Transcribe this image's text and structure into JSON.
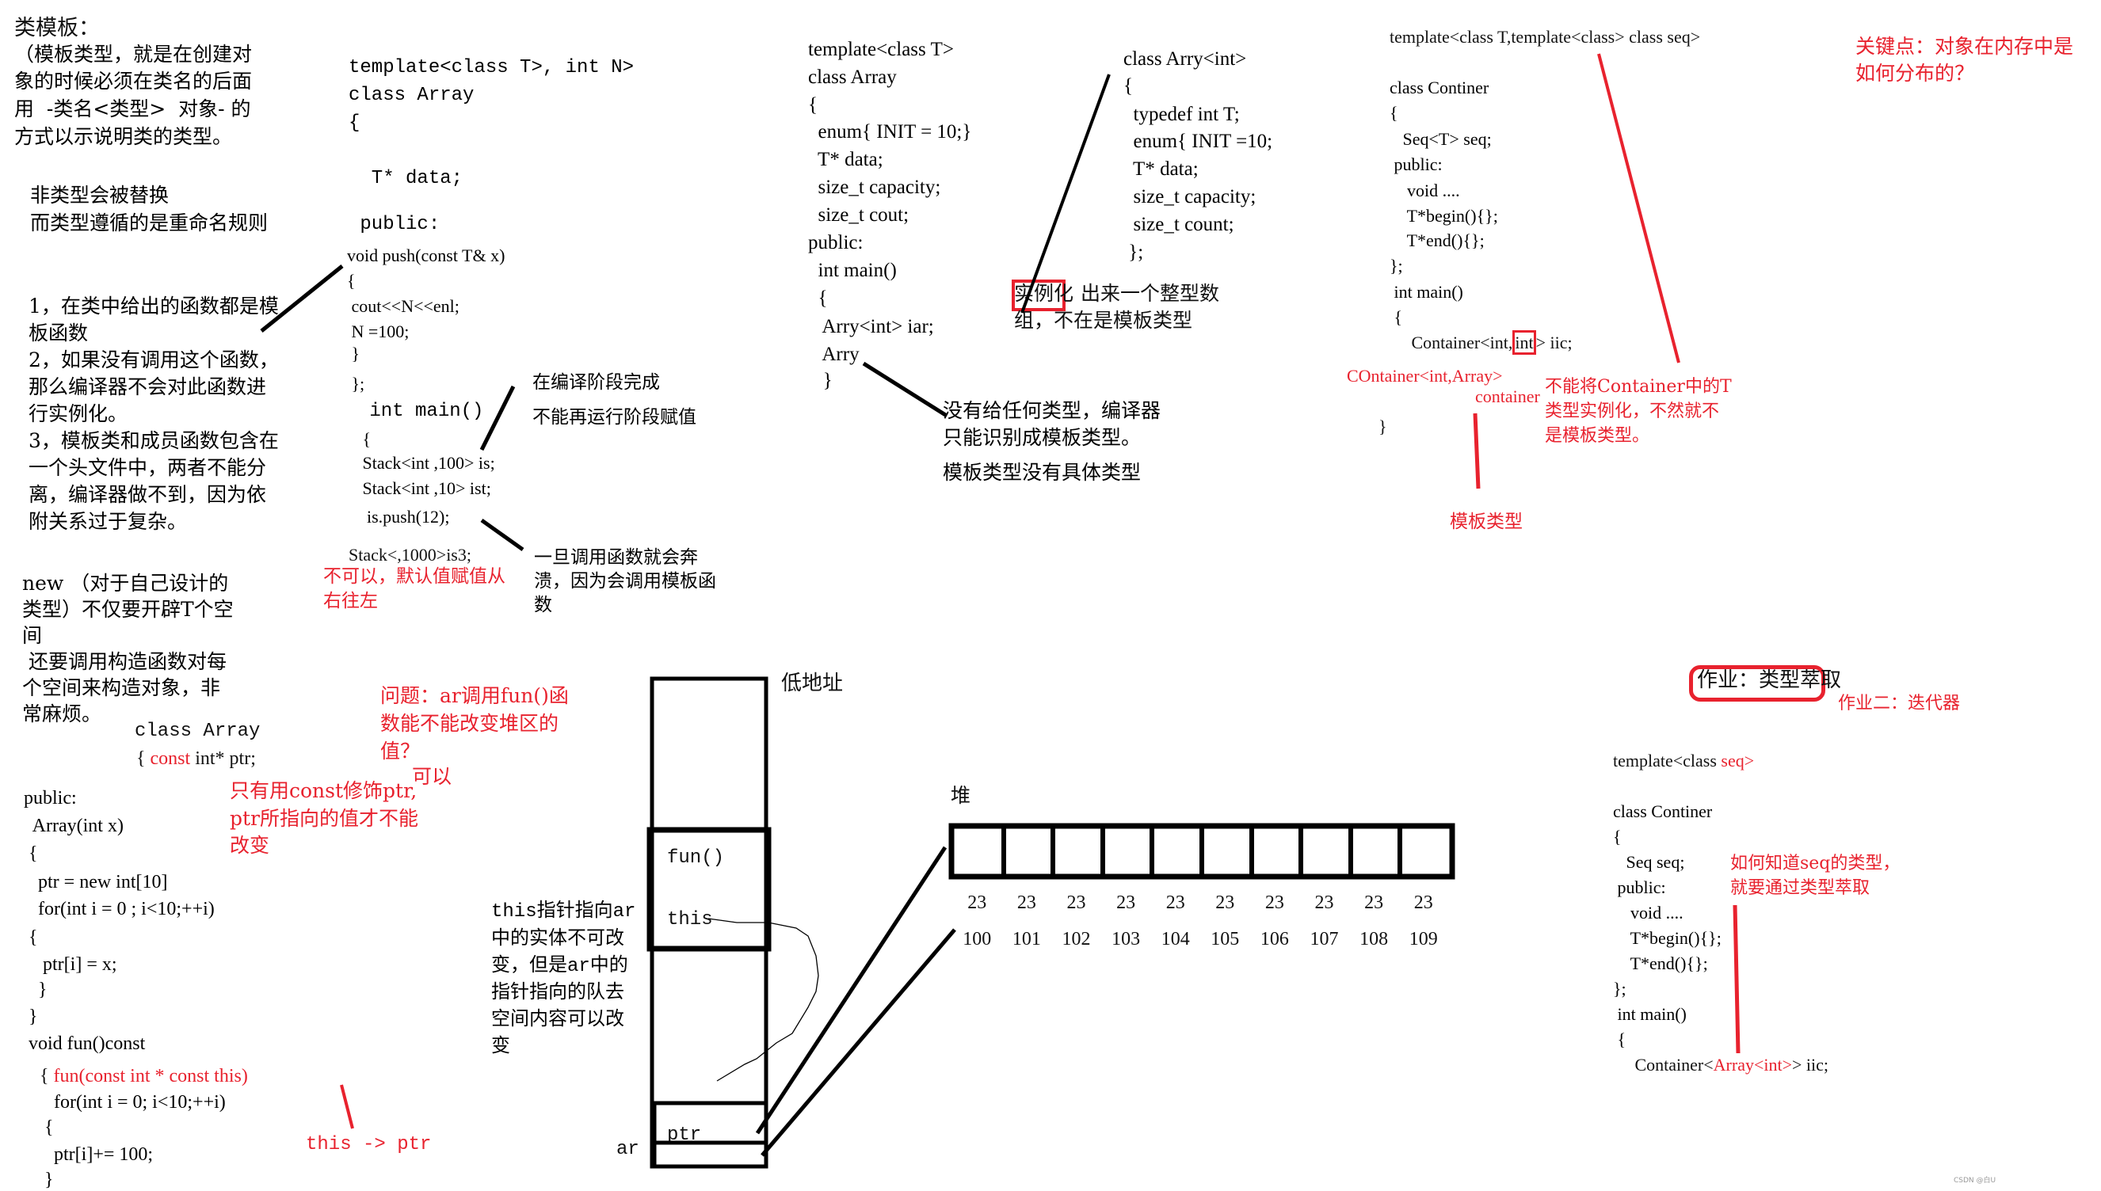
{
  "left_notes": {
    "title": "类模板：",
    "intro": [
      "（模板类型，就是在创建对",
      "象的时候必须在类名的后面",
      "用  -类名<类型>  对象- 的",
      "方式以示说明类的类型。"
    ],
    "rule": [
      "非类型会被替换",
      "而类型遵循的是重命名规则"
    ],
    "points": [
      "1，在类中给出的函数都是模",
      "板函数",
      "2，如果没有调用这个函数，",
      "那么编译器不会对此函数进",
      "行实例化。",
      "3，模板类和成员函数包含在",
      "一个头文件中，两者不能分",
      "离，编译器做不到，因为依",
      "附关系过于复杂。"
    ],
    "new_note": [
      "new （对于自己设计的",
      "类型）不仅要开辟T个空",
      "间",
      " 还要调用构造函数对每",
      "个空间来构造对象，非",
      "常麻烦。"
    ]
  },
  "code_stack": {
    "lines": [
      "template<class T>, int N>",
      "class Array",
      "{",
      "",
      "  T* data;",
      "",
      " public:",
      "void push(const T& x)",
      "{",
      " cout<<N<<enl;",
      " N =100;",
      " }",
      " };",
      " int main()",
      " {",
      " Stack<int ,100> is;",
      " Stack<int ,10> ist;",
      "  is.push(12);"
    ],
    "is3_line": "Stack<,1000>is3;",
    "is3_note": [
      "不可以，默认值赋值从",
      "右往左"
    ],
    "compile_note": [
      "在编译阶段完成",
      "不能再运行阶段赋值"
    ],
    "crash_note": [
      "一旦调用函数就会奔",
      "溃，因为会调用模板函",
      "数"
    ]
  },
  "code_array": {
    "lines": [
      "template<class T>",
      "class Array",
      "{",
      "  enum{ INIT = 10;}",
      "  T* data;",
      "  size_t capacity;",
      "  size_t cout;",
      "public:",
      "  int main()",
      "  {",
      "   Arry<int> iar;",
      "   Arry",
      "   }"
    ],
    "inst_lines": [
      "class Arry<int>",
      "{",
      "  typedef int T;",
      "  enum{ INIT =10;",
      "  T* data;",
      "  size_t capacity;",
      "  size_t count;",
      " };"
    ],
    "inst_highlight": "实例化",
    "inst_note_rest": "出来一个整型数",
    "inst_note_line2": "组，不在是模板类型",
    "no_type_note": [
      "没有给任何类型，编译器",
      "只能识别成模板类型。",
      "模板类型没有具体类型"
    ]
  },
  "code_container": {
    "header": "template<class T,template<class> class seq>",
    "lines": [
      "class Continer",
      "{",
      "   Seq<T> seq;",
      " public:",
      "    void ....",
      "    T*begin(){};",
      "    T*end(){};",
      "};",
      " int main()",
      " {"
    ],
    "decl_prefix": "     Container<int,",
    "decl_boxed": "int",
    "decl_suffix": "> iic;",
    "red_decl": "COntainer<int,Array>",
    "red_container": "container",
    "close_brace": "}",
    "template_type_note": "模板类型",
    "cannot_note": [
      "不能将Container中的T",
      "类型实例化，不然就不",
      "是模板类型。"
    ]
  },
  "key_point": [
    "关键点：对象在内存中是",
    "如何分布的？"
  ],
  "homework": {
    "title": "作业：类型萃取",
    "second": "作业二：迭代器",
    "header_prefix": "template<class",
    "header_red": "seq>",
    "lines": [
      "class Continer",
      "{",
      "   Seq seq;",
      " public:",
      "    void ....",
      "    T*begin(){};",
      "    T*end(){};",
      "};",
      " int main()",
      " {"
    ],
    "seq_note": [
      "如何知道seq的类型，",
      "就要通过类型萃取"
    ],
    "decl_prefix": "     Container<",
    "decl_red": "Array<int>",
    "decl_suffix": "> iic;"
  },
  "const_code": {
    "lines_a": [
      "class Array"
    ],
    "const_line_brace": "{ ",
    "const_line_red": "const",
    "const_line_rest": " int* ptr;",
    "lines_b": [
      "public:",
      "  Array(int x)",
      " {",
      "   ptr = new int[10]",
      "   for(int i = 0 ; i<10;++i)",
      " {",
      "    ptr[i] = x;",
      "   }",
      " }",
      " void fun()const"
    ],
    "fun_brace": "{ ",
    "fun_red": "fun(const int * const this)",
    "lines_c": [
      "   for(int i = 0; i<10;++i)",
      " {",
      "   ptr[i]+= 100;",
      " }"
    ],
    "this_ptr": "this -> ptr",
    "question": [
      "问题：ar调用fun()函",
      "数能不能改变堆区的",
      "值？"
    ],
    "can": "可以",
    "only_const": [
      "只有用const修饰ptr,",
      "ptr所指向的值才不能",
      "改变"
    ]
  },
  "memory": {
    "low_addr": "低地址",
    "fun_label": "fun()",
    "this_label": "this",
    "ptr_label": "ptr",
    "ar_label": "ar",
    "this_note": [
      "this指针指向ar",
      "中的实体不可改",
      "变，但是ar中的",
      "指针指向的队去",
      "空间内容可以改",
      "变"
    ],
    "heap_label": "堆",
    "cell_values": [
      "23",
      "23",
      "23",
      "23",
      "23",
      "23",
      "23",
      "23",
      "23",
      "23"
    ],
    "cell_addrs": [
      "100",
      "101",
      "102",
      "103",
      "104",
      "105",
      "106",
      "107",
      "108",
      "109"
    ]
  },
  "watermark": "CSDN @白U",
  "colors": {
    "annotation_red": "#e8222e",
    "ink": "#111111"
  }
}
